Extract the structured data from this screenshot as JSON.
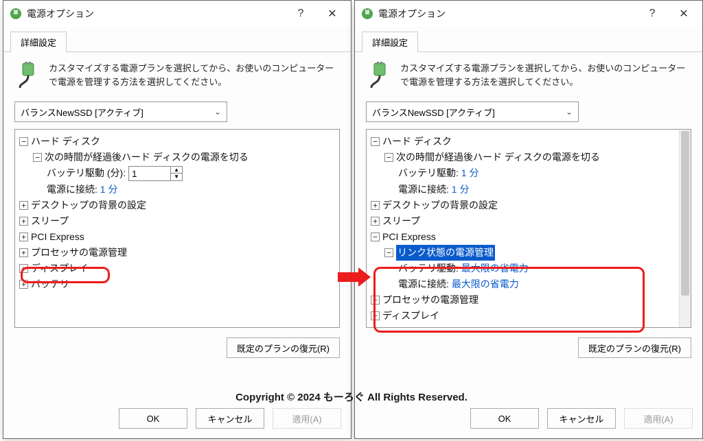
{
  "shared": {
    "window_title": "電源オプション",
    "tab_label": "詳細設定",
    "desc": "カスタマイズする電源プランを選択してから、お使いのコンピューターで電源を管理する方法を選択してください。",
    "plan": "バランスNewSSD [アクティブ]",
    "restore_btn": "既定のプランの復元(R)",
    "ok": "OK",
    "cancel": "キャンセル",
    "apply": "適用(A)",
    "copyright": "Copyright © 2024 もーろぐ All Rights Reserved."
  },
  "left": {
    "tree": {
      "hdd": "ハード ディスク",
      "hdd_turnoff": "次の時間が経過後ハード ディスクの電源を切る",
      "battery_min_label": "バッテリ駆動 (分):",
      "battery_min_value": "1",
      "plugged_label": "電源に接続:",
      "plugged_value": "1 分",
      "desktop_bg": "デスクトップの背景の設定",
      "sleep": "スリープ",
      "pci": "PCI Express",
      "cpu": "プロセッサの電源管理",
      "display": "ディスプレイ",
      "battery": "バッテリ"
    }
  },
  "right": {
    "tree": {
      "hdd": "ハード ディスク",
      "hdd_turnoff": "次の時間が経過後ハード ディスクの電源を切る",
      "battery_label": "バッテリ駆動:",
      "battery_value": "1 分",
      "plugged_label": "電源に接続:",
      "plugged_value": "1 分",
      "desktop_bg": "デスクトップの背景の設定",
      "sleep": "スリープ",
      "pci": "PCI Express",
      "pci_link": "リンク状態の電源管理",
      "pci_batt_label": "バッテリ駆動:",
      "pci_batt_value": "最大限の省電力",
      "pci_plug_label": "電源に接続:",
      "pci_plug_value": "最大限の省電力",
      "cpu": "プロセッサの電源管理",
      "display": "ディスプレイ"
    }
  }
}
